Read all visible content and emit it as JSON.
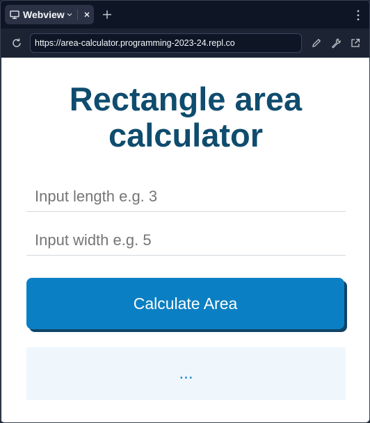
{
  "browser": {
    "tab": {
      "label": "Webview",
      "icon": "monitor-icon"
    },
    "url": "https://area-calculator.programming-2023-24.repl.co"
  },
  "page": {
    "heading": "Rectangle area calculator",
    "length_input": {
      "placeholder": "Input length e.g. 3",
      "value": ""
    },
    "width_input": {
      "placeholder": "Input width e.g. 5",
      "value": ""
    },
    "button_label": "Calculate Area",
    "result": "..."
  },
  "colors": {
    "heading": "#0f4c6e",
    "button": "#0b7fc3",
    "button_shadow": "#0f4468",
    "result_bg": "#eff7fd",
    "chrome_bg": "#1c2333"
  }
}
